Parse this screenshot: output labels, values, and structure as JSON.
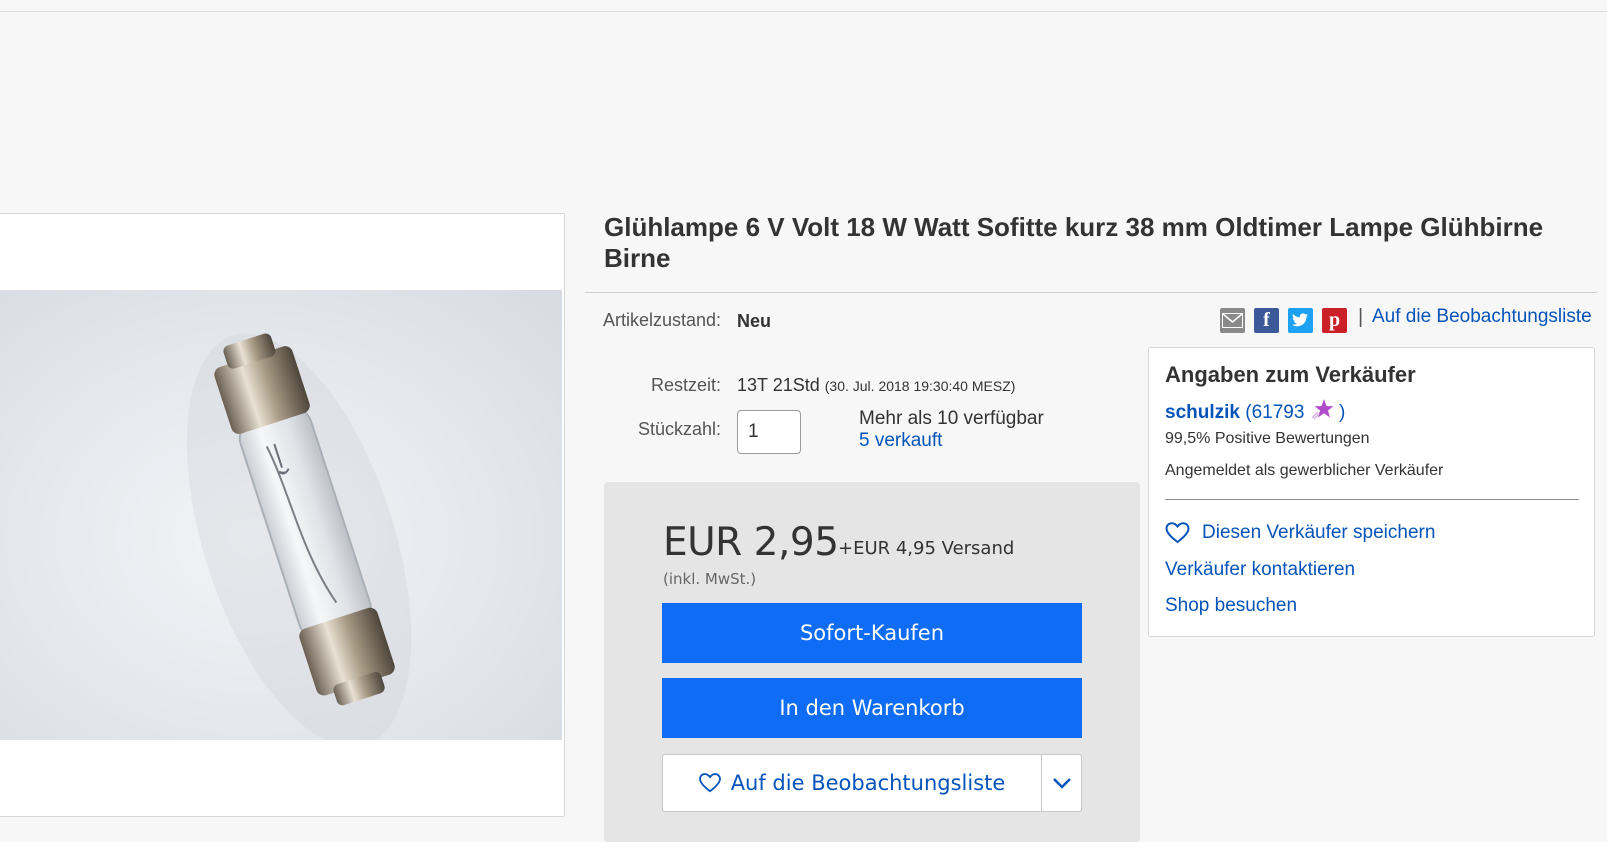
{
  "product": {
    "title": "Glühlampe 6 V Volt 18 W Watt Sofitte kurz 38 mm Oldtimer Lampe Glühbirne Birne"
  },
  "details": {
    "condition_label": "Artikelzustand:",
    "condition_value": "Neu",
    "time_label": "Restzeit:",
    "time_value": "13T 21Std",
    "time_end": "(30. Jul. 2018  19:30:40 MESZ)",
    "qty_label": "Stückzahl:",
    "qty_value": "1",
    "available": "Mehr als 10 verfügbar",
    "sold": "5 verkauft"
  },
  "share": {
    "icons": [
      "email-icon",
      "facebook-icon",
      "twitter-icon",
      "pinterest-icon"
    ],
    "separator": "|",
    "watch_link": "Auf die Beobachtungsliste"
  },
  "buybox": {
    "price": "EUR 2,95",
    "shipping": "+EUR 4,95 Versand",
    "vat_note": "(inkl. MwSt.)",
    "buy_now": "Sofort-Kaufen",
    "add_to_cart": "In den Warenkorb",
    "watchlist": "Auf die Beobachtungsliste"
  },
  "seller": {
    "heading": "Angaben zum Verkäufer",
    "name": "schulzik",
    "feedback_open": "(61793",
    "feedback_close": ")",
    "positive": "99,5% Positive Bewertungen",
    "registered": "Angemeldet als gewerblicher Verkäufer",
    "save": "Diesen Verkäufer speichern",
    "contact": "Verkäufer kontaktieren",
    "shop": "Shop besuchen"
  },
  "colors": {
    "link": "#0654ba",
    "button_blue": "#0e6cf5",
    "buybox_bg": "#e5e5e5",
    "facebook": "#3b5998",
    "twitter": "#1da1f2",
    "pinterest": "#cb2027",
    "star": "#b04ec9"
  }
}
